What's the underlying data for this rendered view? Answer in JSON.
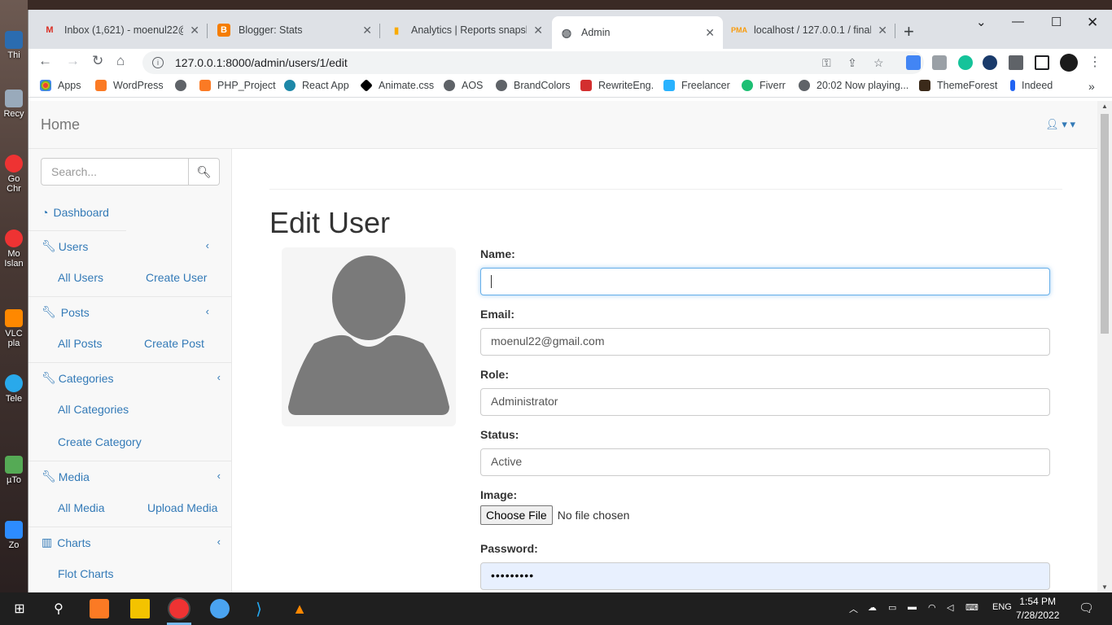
{
  "desktop": {
    "icons": [
      "Thi",
      "Recy",
      "Go Chr",
      "Mo Islan",
      "VLC pla",
      "Tele",
      "µTo",
      "Zo"
    ]
  },
  "browser": {
    "tabs": [
      {
        "title": "Inbox (1,621) - moenul22@",
        "icon": "gmail-icon"
      },
      {
        "title": "Blogger: Stats",
        "icon": "blogger-icon"
      },
      {
        "title": "Analytics | Reports snapshot",
        "icon": "analytics-icon"
      },
      {
        "title": "Admin",
        "icon": "globe-icon"
      },
      {
        "title": "localhost / 127.0.0.1 / final_",
        "icon": "phpmyadmin-icon"
      }
    ],
    "url": "127.0.0.1:8000/admin/users/1/edit",
    "bookmarks": [
      "Apps",
      "WordPress",
      "PHP_Project",
      "React App",
      "Animate.css",
      "AOS",
      "BrandColors",
      "RewriteEng.",
      "Freelancer",
      "Fiverr",
      "20:02 Now playing...",
      "ThemeForest",
      "Indeed"
    ]
  },
  "navbar": {
    "brand": "Home"
  },
  "sidebar": {
    "search_placeholder": "Search...",
    "items": [
      {
        "label": "Dashboard"
      },
      {
        "label": "Users",
        "subs": [
          "All Users",
          "Create User"
        ]
      },
      {
        "label": "Posts",
        "subs": [
          "All Posts",
          "Create Post"
        ]
      },
      {
        "label": "Categories",
        "subs": [
          "All Categories",
          "Create Category"
        ]
      },
      {
        "label": "Media",
        "subs": [
          "All Media",
          "Upload Media"
        ]
      },
      {
        "label": "Charts",
        "subs": [
          "Flot Charts"
        ]
      }
    ]
  },
  "main": {
    "title": "Edit User",
    "fields": {
      "name_label": "Name:",
      "name_value": "",
      "email_label": "Email:",
      "email_value": "moenul22@gmail.com",
      "role_label": "Role:",
      "role_value": "Administrator",
      "status_label": "Status:",
      "status_value": "Active",
      "image_label": "Image:",
      "choose_file": "Choose File",
      "no_file": "No file chosen",
      "password_label": "Password:",
      "password_value": "•••••••••"
    }
  },
  "taskbar": {
    "lang": "ENG",
    "time": "1:54 PM",
    "date": "7/28/2022"
  }
}
